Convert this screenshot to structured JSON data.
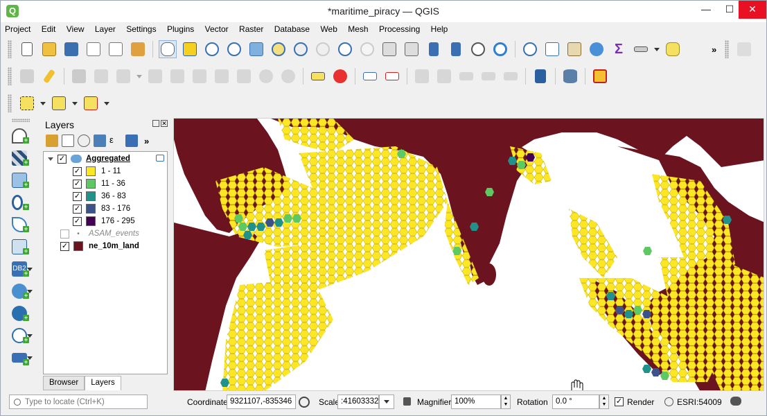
{
  "window": {
    "title": "*maritime_piracy — QGIS",
    "app_icon": "Q",
    "minimize": "—",
    "maximize": "☐",
    "close": "✕"
  },
  "menubar": {
    "items": [
      "Project",
      "Edit",
      "View",
      "Layer",
      "Settings",
      "Plugins",
      "Vector",
      "Raster",
      "Database",
      "Web",
      "Mesh",
      "Processing",
      "Help"
    ]
  },
  "layers_panel": {
    "title": "Layers",
    "float_glyph": "⧉",
    "close_glyph": "✕",
    "more_glyph": "»",
    "tree": {
      "group": {
        "label": "Aggregated",
        "checked": "✓"
      },
      "classes": [
        {
          "label": "1 - 11",
          "color": "#fde725",
          "checked": "✓"
        },
        {
          "label": "11 - 36",
          "color": "#5ec962",
          "checked": "✓"
        },
        {
          "label": "36 - 83",
          "color": "#21918c",
          "checked": "✓"
        },
        {
          "label": "83 - 176",
          "color": "#3b528b",
          "checked": "✓"
        },
        {
          "label": "176 - 295",
          "color": "#440154",
          "checked": "✓"
        }
      ],
      "events_layer": {
        "label": "ASAM_events",
        "bullet": "•"
      },
      "land_layer": {
        "label": "ne_10m_land",
        "color": "#6b1420",
        "checked": "✓"
      }
    },
    "tabs": [
      "Browser",
      "Layers"
    ]
  },
  "statusbar": {
    "locator_placeholder": "Type to locate (Ctrl+K)",
    "coordinate_label": "Coordinate",
    "coordinate_value": "9321107,-835346",
    "scale_label": "Scale",
    "scale_value": ":41603332",
    "magnifier_label": "Magnifier",
    "magnifier_value": "100%",
    "rotation_label": "Rotation",
    "rotation_value": "0.0 °",
    "render_label": "Render",
    "render_checked": "✓",
    "crs_value": "ESRI:54009"
  },
  "colors": {
    "land": "#6b1420",
    "hex_low": "#fde725",
    "hex_mid": "#5ec962",
    "hex_high": "#21918c",
    "hex_higher": "#3b528b",
    "hex_max": "#440154",
    "accent": "#5fb548"
  }
}
